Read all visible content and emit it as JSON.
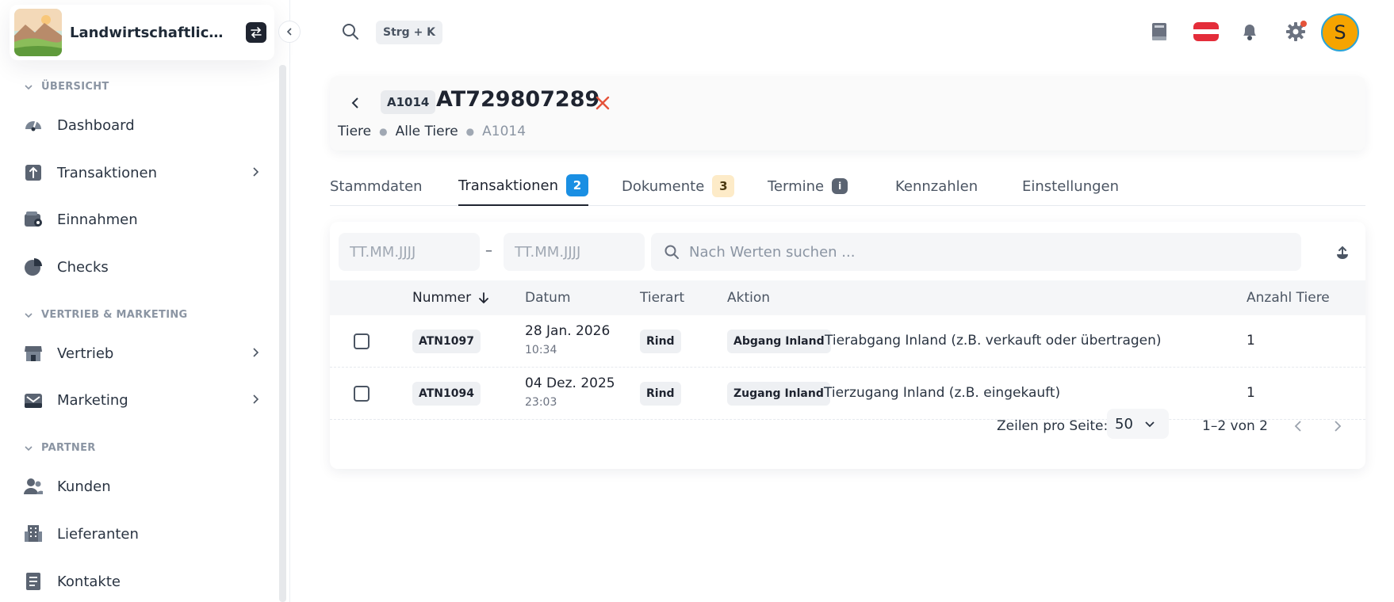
{
  "brand": {
    "name": "Landwirtschaftlicher Betrieb"
  },
  "sidebar": {
    "sections": [
      {
        "title": "ÜBERSICHT"
      },
      {
        "title": "VERTRIEB & MARKETING"
      },
      {
        "title": "PARTNER"
      }
    ],
    "items": [
      {
        "label": "Dashboard",
        "icon": "gauge-icon"
      },
      {
        "label": "Transaktionen",
        "icon": "upload-box-icon",
        "has_children": true
      },
      {
        "label": "Einnahmen",
        "icon": "wallet-icon"
      },
      {
        "label": "Checks",
        "icon": "pie-chart-icon"
      },
      {
        "label": "Vertrieb",
        "icon": "store-icon",
        "has_children": true
      },
      {
        "label": "Marketing",
        "icon": "mail-tray-icon",
        "has_children": true
      },
      {
        "label": "Kunden",
        "icon": "users-icon"
      },
      {
        "label": "Lieferanten",
        "icon": "building-icon"
      },
      {
        "label": "Kontakte",
        "icon": "address-book-icon"
      }
    ]
  },
  "topbar": {
    "shortcut": "Strg + K",
    "avatar_initial": "S"
  },
  "header": {
    "id_chip": "A1014",
    "title": "AT729807289",
    "breadcrumbs": [
      "Tiere",
      "Alle Tiere",
      "A1014"
    ]
  },
  "tabs": [
    {
      "label": "Stammdaten"
    },
    {
      "label": "Transaktionen",
      "badge": "2",
      "active": true
    },
    {
      "label": "Dokumente",
      "badge": "3"
    },
    {
      "label": "Termine",
      "badge": "i"
    },
    {
      "label": "Kennzahlen"
    },
    {
      "label": "Einstellungen"
    }
  ],
  "filters": {
    "date_from_placeholder": "TT.MM.JJJJ",
    "date_separator": "–",
    "date_to_placeholder": "TT.MM.JJJJ",
    "search_placeholder": "Nach Werten suchen ..."
  },
  "table": {
    "columns": [
      "Nummer",
      "Datum",
      "Tierart",
      "Aktion",
      "Anzahl Tiere"
    ],
    "rows": [
      {
        "nummer": "ATN1097",
        "date": "28 Jan. 2026",
        "time": "10:34",
        "tierart": "Rind",
        "aktion": "Abgang Inland",
        "beschreibung": "Tierabgang Inland (z.B. verkauft oder übertragen)",
        "anzahl": "1"
      },
      {
        "nummer": "ATN1094",
        "date": "04 Dez. 2025",
        "time": "23:03",
        "tierart": "Rind",
        "aktion": "Zugang Inland",
        "beschreibung": "Tierzugang Inland (z.B. eingekauft)",
        "anzahl": "1"
      }
    ]
  },
  "pagination": {
    "rows_label": "Zeilen pro Seite:",
    "rows_value": "50",
    "range": "1–2 von 2"
  },
  "colors": {
    "accent_blue": "#1a8fe3",
    "close_red": "#e5533a",
    "avatar": "#f6a400"
  }
}
